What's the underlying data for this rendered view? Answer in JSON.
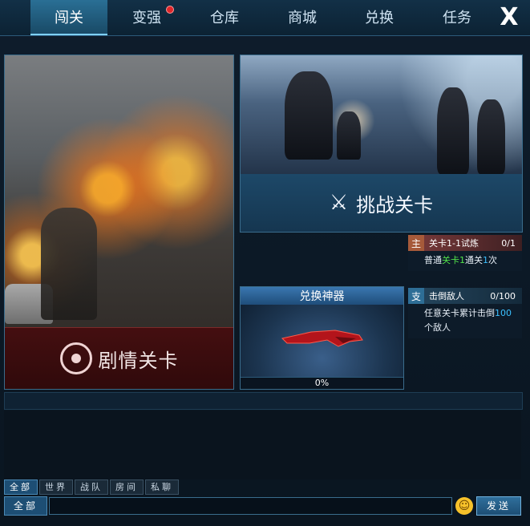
{
  "tabs": [
    {
      "label": "闯关",
      "active": true
    },
    {
      "label": "变强",
      "active": false,
      "badge": true
    },
    {
      "label": "仓库",
      "active": false
    },
    {
      "label": "商城",
      "active": false
    },
    {
      "label": "兑换",
      "active": false
    },
    {
      "label": "任务",
      "active": false
    }
  ],
  "close_label": "X",
  "story": {
    "label": "剧情关卡"
  },
  "challenge": {
    "label": "挑战关卡"
  },
  "quests": [
    {
      "tag": "主",
      "title": "关卡1-1试炼",
      "count": "0/1",
      "desc_prefix": "普通",
      "desc_highlight": "关卡1",
      "desc_mid": "通关",
      "desc_num": "1",
      "desc_suffix": "次"
    },
    {
      "tag": "支",
      "title": "击倒敌人",
      "count": "0/100",
      "desc_prefix": "任意关卡累计击倒",
      "desc_num": "100",
      "desc_suffix": "个敌人"
    }
  ],
  "exchange": {
    "title": "兑换神器",
    "progress_text": "0%",
    "progress": 0
  },
  "chat": {
    "tabs": [
      {
        "label": "全部",
        "active": true
      },
      {
        "label": "世界",
        "active": false
      },
      {
        "label": "战队",
        "active": false
      },
      {
        "label": "房间",
        "active": false
      },
      {
        "label": "私聊",
        "active": false
      }
    ],
    "channel_label": "全部",
    "input_value": "",
    "send_label": "发送"
  },
  "colors": {
    "accent": "#2a6f95",
    "quest_highlight_green": "#53e34a",
    "quest_highlight_cyan": "#3bc1ff",
    "story_bar": "#460c0e"
  }
}
